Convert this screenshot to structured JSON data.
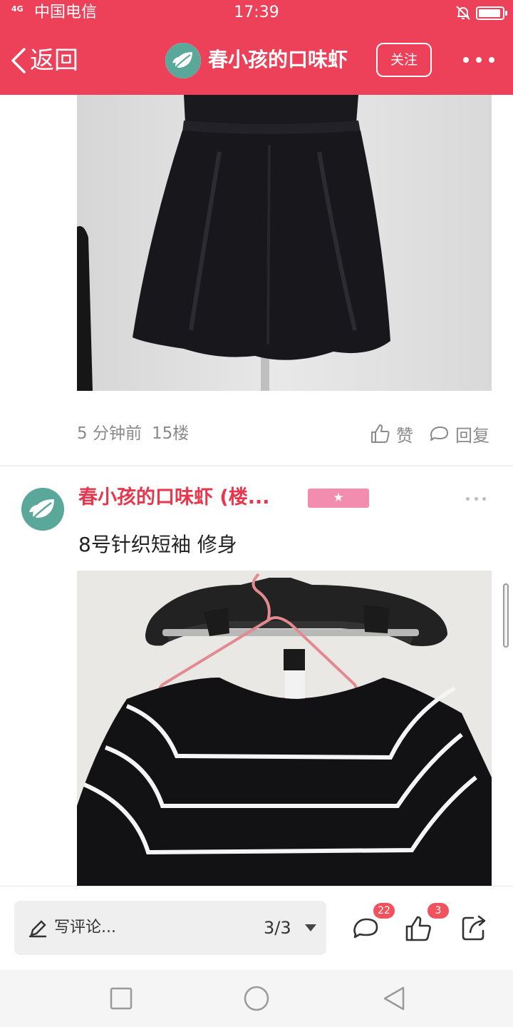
{
  "status_bar": {
    "signal": "4G",
    "carrier": "中国电信",
    "time": "17:39",
    "icons": [
      "signal-icon",
      "bell-muted-icon",
      "battery-icon"
    ]
  },
  "nav": {
    "back_label": "返回",
    "title": "春小孩的口味虾",
    "follow_label": "关注",
    "more_icon": "more-dots-icon"
  },
  "floor_meta": {
    "time_ago": "5 分钟前",
    "floor": "15楼",
    "like_label": "赞",
    "reply_label": "回复"
  },
  "post": {
    "author": "春小孩的口味虾 (楼...",
    "badge": "★",
    "text": "8号针织短袖 修身"
  },
  "bottom_bar": {
    "comment_placeholder": "写评论...",
    "page_indicator": "3/3",
    "comment_count": "22",
    "like_count": "3"
  },
  "colors": {
    "brand_red": "#ec4158",
    "author_red": "#e8364d",
    "badge_pink": "#f28db0",
    "count_badge": "#f2515e"
  }
}
